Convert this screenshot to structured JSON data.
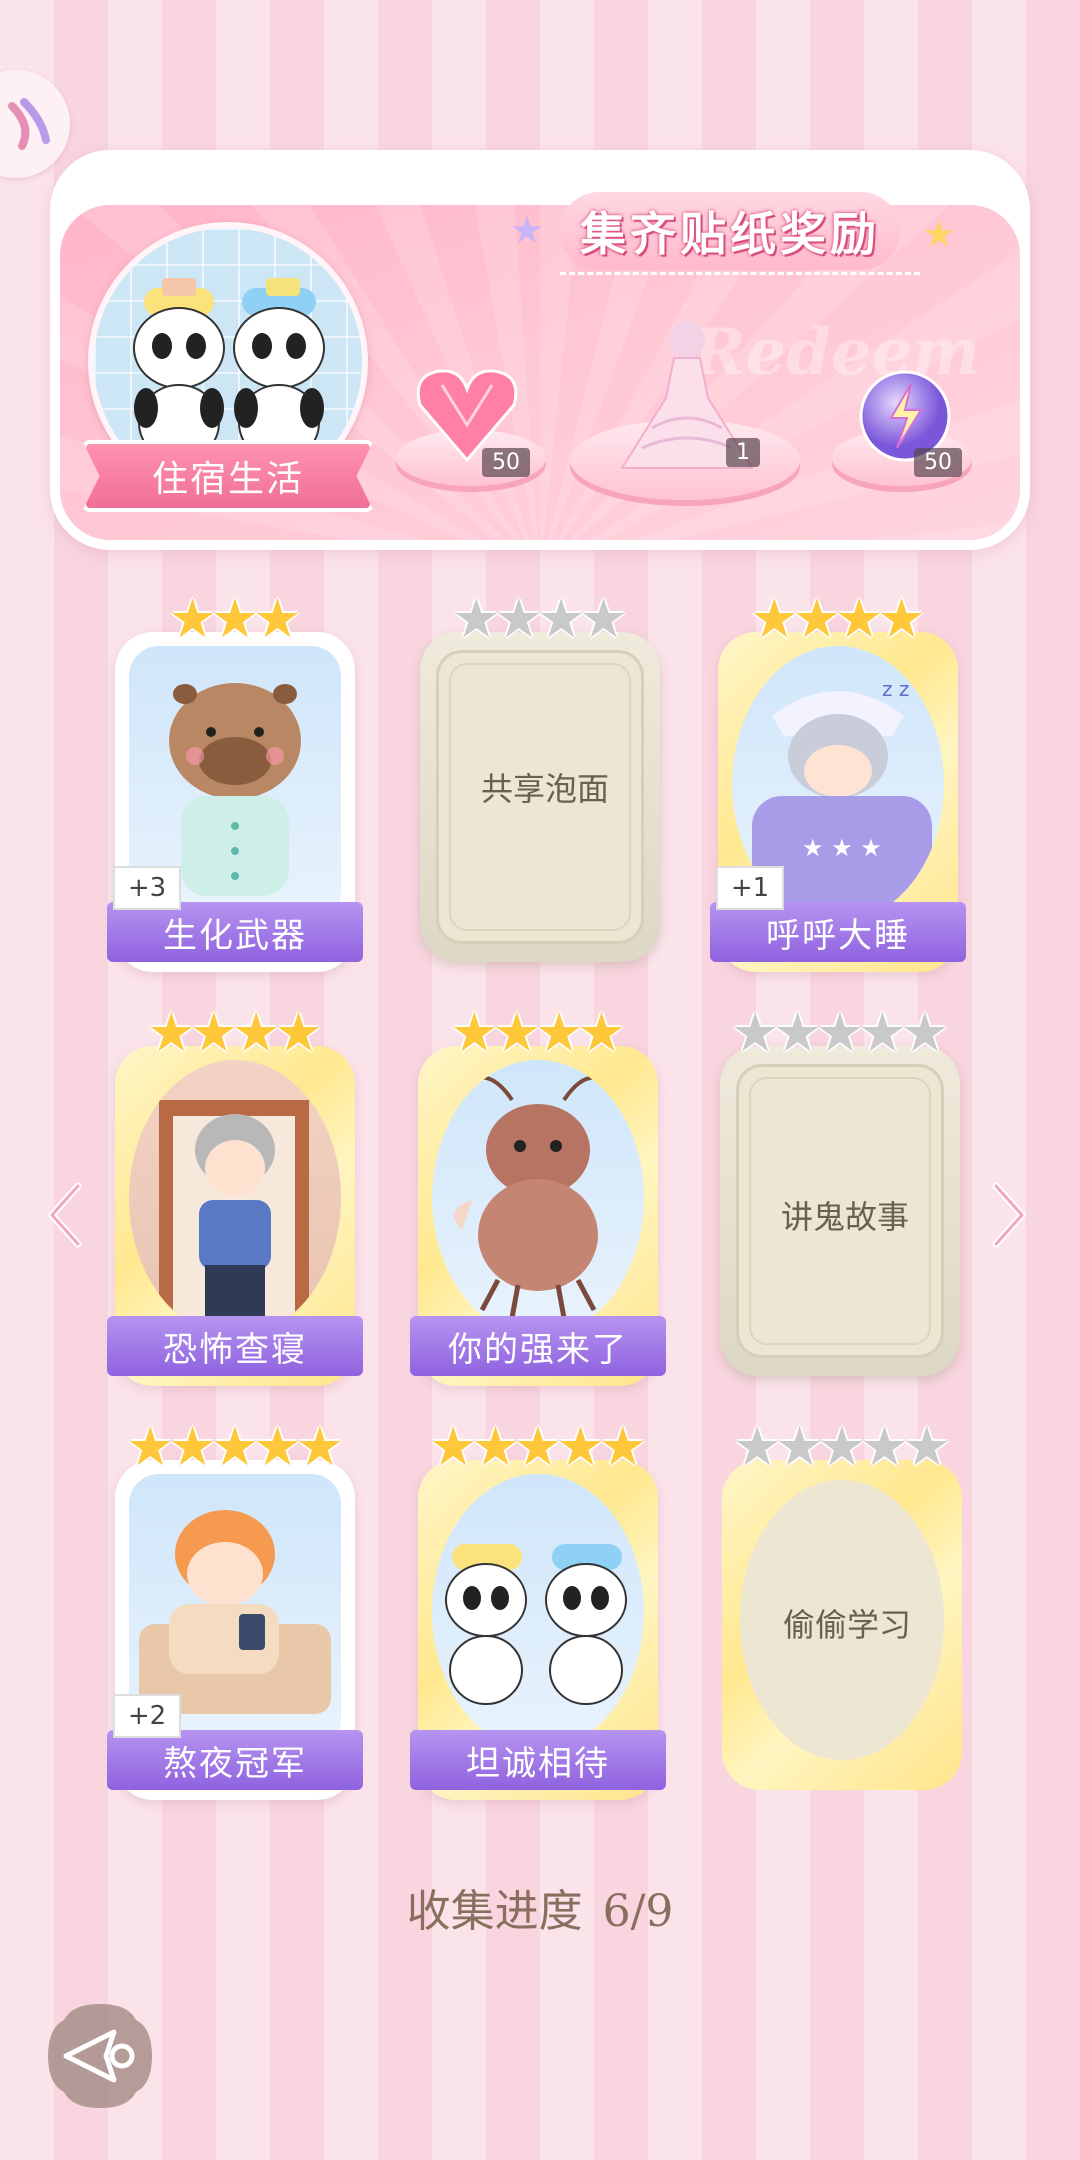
{
  "header": {
    "reward_title": "集齐贴纸奖励",
    "watermark": "Redeem",
    "theme_label": "住宿生活"
  },
  "rewards": [
    {
      "icon": "pink-heart-gem-icon",
      "count": "50"
    },
    {
      "icon": "outfit-dress-icon",
      "count": "1"
    },
    {
      "icon": "purple-lightning-orb-icon",
      "count": "50"
    }
  ],
  "stickers": [
    {
      "name": "生化武器",
      "stars": 3,
      "max_stars": 3,
      "collected": true,
      "frame": "white",
      "bonus": "+3",
      "art": "capybara-pajama"
    },
    {
      "name": "共享泡面",
      "stars": 0,
      "max_stars": 4,
      "collected": false,
      "frame": "locked"
    },
    {
      "name": "呼呼大睡",
      "stars": 4,
      "max_stars": 4,
      "collected": true,
      "frame": "gold",
      "bonus": "+1",
      "art": "sleeping-boy"
    },
    {
      "name": "恐怖查寝",
      "stars": 4,
      "max_stars": 4,
      "collected": true,
      "frame": "gold",
      "art": "dorm-auntie"
    },
    {
      "name": "你的强来了",
      "stars": 4,
      "max_stars": 4,
      "collected": true,
      "frame": "gold",
      "art": "cockroach"
    },
    {
      "name": "讲鬼故事",
      "stars": 0,
      "max_stars": 5,
      "collected": false,
      "frame": "locked"
    },
    {
      "name": "熬夜冠军",
      "stars": 5,
      "max_stars": 5,
      "collected": true,
      "frame": "white",
      "bonus": "+2",
      "art": "phone-in-bed"
    },
    {
      "name": "坦诚相待",
      "stars": 5,
      "max_stars": 5,
      "collected": true,
      "frame": "gold",
      "art": "pandas-shower"
    },
    {
      "name": "偷偷学习",
      "stars": 0,
      "max_stars": 5,
      "collected": false,
      "frame": "gold-oval"
    }
  ],
  "progress": {
    "label": "收集进度",
    "value": "6/9"
  },
  "nav": {
    "prev_icon": "chevron-left-icon",
    "next_icon": "chevron-right-icon",
    "back_icon": "back-icon"
  },
  "colors": {
    "accent_pink": "#f06f97",
    "name_bar_purple": "#8f62df",
    "star_gold": "#ffc83a",
    "star_gray": "#c9c9c9",
    "progress_text": "#8a6e5e"
  }
}
